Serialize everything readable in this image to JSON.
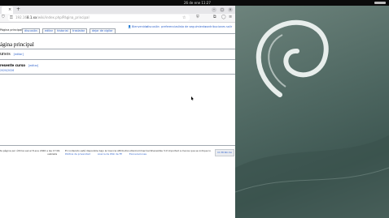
{
  "system": {
    "clock": "26 de ene  11:27"
  },
  "browser": {
    "url_prefix": "192.16",
    "url_host": "8.1.xx",
    "url_path": "/wiki/index.php/Página_principal",
    "tab_close": "×",
    "new_tab": "+"
  },
  "wiki": {
    "personal_links": [
      "Bienvenido",
      "discusión",
      "preferencias",
      "lista de seguimiento",
      "contribuciones",
      "salir"
    ],
    "tabs": {
      "page": "Página principal",
      "discussion": "discusión",
      "edit": "editar",
      "history": "historial",
      "move": "trasladar",
      "watch": "dejar de vigilar"
    },
    "page_title": "ágina principal",
    "section_heading": "ursos",
    "section_edit": "[editar]",
    "subsection_heading": "resente curso",
    "subsection_edit": "[editar]",
    "subsection_link": "2020/2026",
    "footer": {
      "left": "ta página por última vez el 8 ene 2026 a las 17:06. ",
      "left2": "ualizada",
      "license": "El contenido está disponible bajo la licencia Attribution-NonCommercial-ShareAlike 3.0 Unported a menos que se indique lo contrario.",
      "links": [
        "Política de privacidad",
        "Acerca de Wiki de FP",
        "Exoneraciones"
      ],
      "badge": "CC BY-NC-SA"
    }
  }
}
